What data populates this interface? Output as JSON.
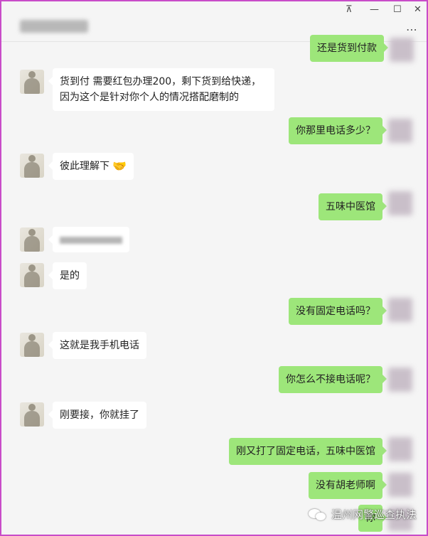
{
  "window": {
    "controls": {
      "pin": "⊼",
      "minimize": "—",
      "maximize": "☐",
      "close": "✕"
    },
    "more_menu": "⋮⋮⋮",
    "contact_name_blurred": true
  },
  "messages": [
    {
      "side": "out",
      "text": "还是货到付款"
    },
    {
      "side": "in",
      "text": "货到付 需要红包办理200，剩下货到给快递，因为这个是针对你个人的情况搭配磨制的"
    },
    {
      "side": "out",
      "text": "你那里电话多少？"
    },
    {
      "side": "in",
      "text": "彼此理解下",
      "emoji": "🤝"
    },
    {
      "side": "out",
      "text": "五味中医馆"
    },
    {
      "side": "in",
      "text": "",
      "blurred": true
    },
    {
      "side": "in",
      "text": "是的"
    },
    {
      "side": "out",
      "text": "没有固定电话吗？"
    },
    {
      "side": "in",
      "text": "这就是我手机电话"
    },
    {
      "side": "out",
      "text": "你怎么不接电话呢？"
    },
    {
      "side": "in",
      "text": "刚要接，你就挂了"
    },
    {
      "side": "out",
      "text": "刚又打了固定电话，五味中医馆"
    },
    {
      "side": "out",
      "text": "没有胡老师啊"
    },
    {
      "side": "out",
      "text": "你",
      "partially_hidden": true
    }
  ],
  "watermark": {
    "icon": "wechat-icon",
    "text": "温州网警巡查执法"
  },
  "colors": {
    "frame": "#c84cc8",
    "outgoing_bubble": "#9de67a",
    "incoming_bubble": "#ffffff",
    "background": "#f5f5f5"
  }
}
